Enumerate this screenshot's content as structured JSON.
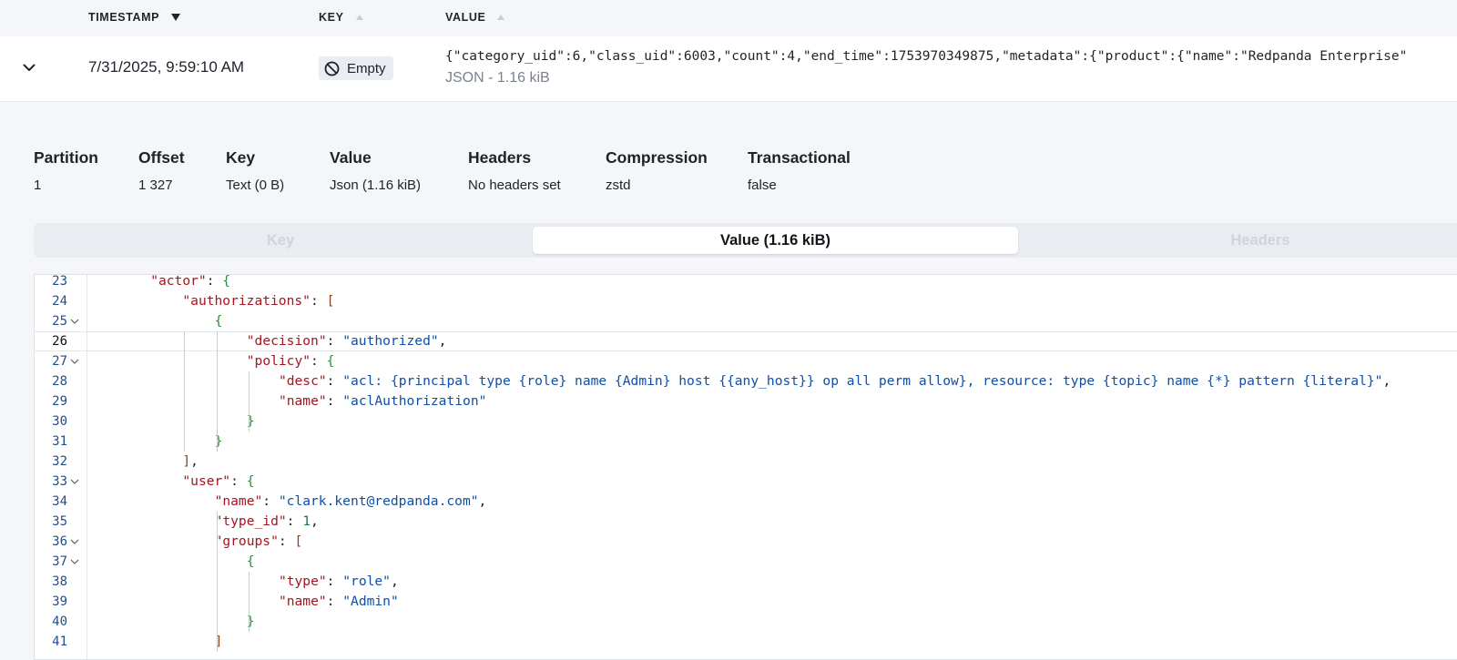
{
  "table": {
    "headers": {
      "timestamp": "TIMESTAMP",
      "key": "KEY",
      "value": "VALUE"
    },
    "row": {
      "timestamp": "7/31/2025, 9:59:10 AM",
      "key_badge": "Empty",
      "value_preview": "{\"category_uid\":6,\"class_uid\":6003,\"count\":4,\"end_time\":1753970349875,\"metadata\":{\"product\":{\"name\":\"Redpanda Enterprise\"",
      "value_meta": "JSON - 1.16 kiB"
    }
  },
  "meta": [
    {
      "label": "Partition",
      "value": "1"
    },
    {
      "label": "Offset",
      "value": "1 327"
    },
    {
      "label": "Key",
      "value": "Text (0 B)"
    },
    {
      "label": "Value",
      "value": "Json (1.16 kiB)"
    },
    {
      "label": "Headers",
      "value": "No headers set"
    },
    {
      "label": "Compression",
      "value": "zstd"
    },
    {
      "label": "Transactional",
      "value": "false"
    }
  ],
  "tabs": {
    "key": "Key",
    "value": "Value (1.16 kiB)",
    "headers": "Headers"
  },
  "editor": {
    "active_line": 26,
    "lines": [
      {
        "n": "23",
        "code": "    \"actor\": {"
      },
      {
        "n": "24",
        "code": "        \"authorizations\": ["
      },
      {
        "n": "25",
        "code": "            {"
      },
      {
        "n": "26",
        "code": "                \"decision\": \"authorized\","
      },
      {
        "n": "27",
        "code": "                \"policy\": {"
      },
      {
        "n": "28",
        "code": "                    \"desc\": \"acl: {principal type {role} name {Admin} host {{any_host}} op all perm allow}, resource: type {topic} name {*} pattern {literal}\","
      },
      {
        "n": "29",
        "code": "                    \"name\": \"aclAuthorization\""
      },
      {
        "n": "30",
        "code": "                }"
      },
      {
        "n": "31",
        "code": "            }"
      },
      {
        "n": "32",
        "code": "        ],"
      },
      {
        "n": "33",
        "code": "        \"user\": {"
      },
      {
        "n": "34",
        "code": "            \"name\": \"clark.kent@redpanda.com\","
      },
      {
        "n": "35",
        "code": "            \"type_id\": 1,"
      },
      {
        "n": "36",
        "code": "            \"groups\": ["
      },
      {
        "n": "37",
        "code": "                {"
      },
      {
        "n": "38",
        "code": "                    \"type\": \"role\","
      },
      {
        "n": "39",
        "code": "                    \"name\": \"Admin\""
      },
      {
        "n": "40",
        "code": "                }"
      },
      {
        "n": "41",
        "code": "            ]"
      }
    ]
  },
  "colors": {
    "json_key": "#a3151f",
    "json_string": "#0f4fa8",
    "json_number": "#1b7a3c",
    "line_number": "#1f4f8a"
  },
  "icons": {
    "expand": "chevron-down-icon",
    "sort_active": "sort-descending-icon",
    "sort_inactive": "sort-ascending-icon",
    "empty": "circle-slash-icon",
    "fold": "fold-chevron-icon"
  }
}
